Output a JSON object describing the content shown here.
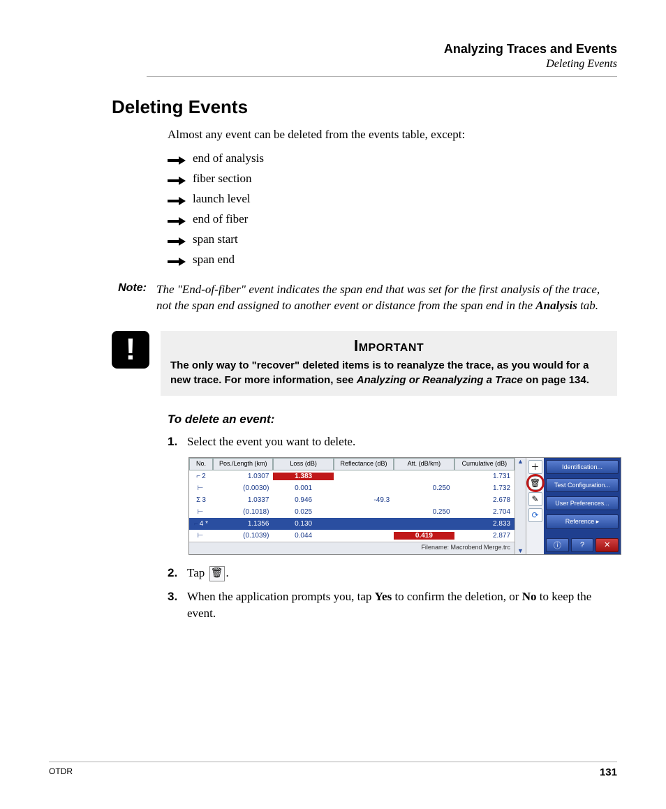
{
  "header": {
    "chapter": "Analyzing Traces and Events",
    "section": "Deleting Events"
  },
  "heading": "Deleting Events",
  "intro": "Almost any event can be deleted from the events table, except:",
  "bullets": [
    "end of analysis",
    "fiber section",
    "launch level",
    "end of fiber",
    "span start",
    "span end"
  ],
  "note": {
    "label": "Note:",
    "text_pre": "The \"End-of-fiber\" event indicates the span end that was set for the first analysis of the trace, not the span end assigned to another event or distance from the span end in the ",
    "bold": "Analysis",
    "text_post": " tab."
  },
  "important": {
    "title": "Important",
    "text_pre": "The only way to \"recover\" deleted items is to reanalyze the trace, as you would for a new trace. For more information, see ",
    "em": "Analyzing or Reanalyzing a Trace",
    "text_post": " on page 134."
  },
  "procedure_title": "To delete an event:",
  "steps": {
    "s1": {
      "num": "1.",
      "text": "Select the event you want to delete."
    },
    "s2": {
      "num": "2.",
      "pre": "Tap ",
      "post": "."
    },
    "s3": {
      "num": "3.",
      "pre": "When the application prompts you, tap ",
      "yes": "Yes",
      "mid": " to confirm the deletion, or ",
      "no": "No",
      "post": " to keep the event."
    }
  },
  "screenshot": {
    "headers": [
      "No.",
      "Pos./Length (km)",
      "Loss (dB)",
      "Reflectance (dB)",
      "Att. (dB/km)",
      "Cumulative (dB)"
    ],
    "rows": [
      {
        "no": "2",
        "pos": "1.0307",
        "loss": "1.383",
        "loss_red": true,
        "refl": "",
        "att": "",
        "cum": "1.731",
        "sel": false,
        "sym": "⌐"
      },
      {
        "no": "",
        "pos": "(0.0030)",
        "loss": "0.001",
        "loss_red": false,
        "refl": "",
        "att": "0.250",
        "cum": "1.732",
        "sel": false,
        "sym": "⊢"
      },
      {
        "no": "3",
        "pos": "1.0337",
        "loss": "0.946",
        "loss_red": false,
        "refl": "-49.3",
        "att": "",
        "cum": "2.678",
        "sel": false,
        "sym": "Σ"
      },
      {
        "no": "",
        "pos": "(0.1018)",
        "loss": "0.025",
        "loss_red": false,
        "refl": "",
        "att": "0.250",
        "cum": "2.704",
        "sel": false,
        "sym": "⊢"
      },
      {
        "no": "4 *",
        "pos": "1.1356",
        "loss": "0.130",
        "loss_red": false,
        "refl": "",
        "att": "",
        "cum": "2.833",
        "sel": true,
        "sym": "⌐"
      },
      {
        "no": "",
        "pos": "(0.1039)",
        "loss": "0.044",
        "loss_red": false,
        "refl": "",
        "att": "0.419",
        "att_red": true,
        "cum": "2.877",
        "sel": false,
        "sym": "⊢"
      }
    ],
    "footer": "Filename: Macrobend  Merge.trc",
    "side_buttons": [
      "Identification...",
      "Test Configuration...",
      "User Preferences...",
      "Reference    ▸"
    ]
  },
  "footer": {
    "left": "OTDR",
    "right": "131"
  }
}
